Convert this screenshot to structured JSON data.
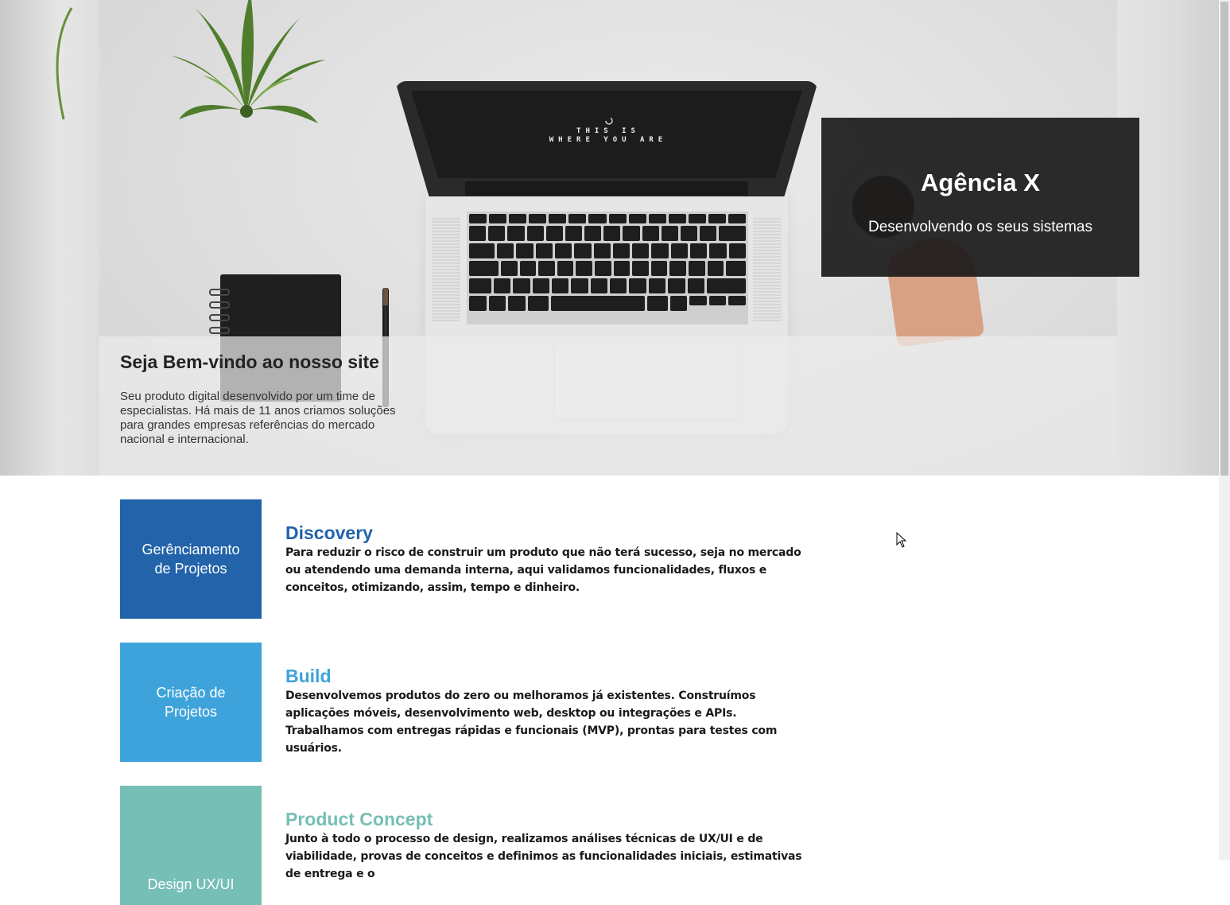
{
  "hero": {
    "title": "Agência X",
    "subtitle": "Desenvolvendo os seus sistemas",
    "laptop_screen_text_line1": "THIS IS",
    "laptop_screen_text_line2": "WHERE YOU ARE"
  },
  "welcome": {
    "heading": "Seja Bem-vindo ao nosso site",
    "text": "Seu produto digital desenvolvido por um time de especialistas. Há mais de 11 anos criamos soluções para grandes empresas referências do mercado nacional e internacional."
  },
  "services": [
    {
      "box_label": "Gerênciamento de Projetos",
      "title": "Discovery",
      "color": "#2263aa",
      "description": "Para reduzir o risco de construir um produto que não terá sucesso, seja no mercado ou atendendo uma demanda interna, aqui validamos funcionalidades, fluxos e conceitos, otimizando, assim, tempo e dinheiro."
    },
    {
      "box_label": "Criação de Projetos",
      "title": "Build",
      "color": "#3ea3da",
      "description": "Desenvolvemos produtos do zero ou melhoramos já existentes. Construímos aplicações móveis, desenvolvimento web, desktop ou integrações e APIs. Trabalhamos com entregas rápidas e funcionais (MVP), prontas para testes com usuários."
    },
    {
      "box_label": "Design UX/UI",
      "title": "Product Concept",
      "color": "#76bfb6",
      "description": "Junto à todo o processo de design, realizamos análises técnicas de UX/UI e de viabilidade, provas de conceitos e definimos as funcionalidades iniciais, estimativas de entrega e o"
    }
  ],
  "icons": {
    "cursor": "mouse-pointer-icon"
  }
}
